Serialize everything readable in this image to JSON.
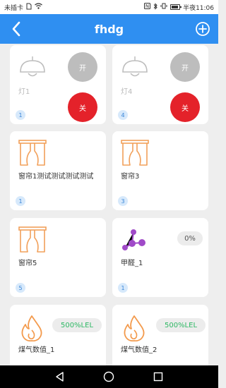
{
  "status": {
    "carrier": "未插卡",
    "time_label": "半夜11:06"
  },
  "header": {
    "title": "fhdg"
  },
  "cards": {
    "light1": {
      "name": "灯1",
      "on_label": "开",
      "off_label": "关",
      "badge": "1"
    },
    "light4": {
      "name": "灯4",
      "on_label": "开",
      "off_label": "关",
      "badge": "4"
    },
    "curtain1": {
      "name": "窗帘1测试测试测试测试",
      "badge": "1"
    },
    "curtain3": {
      "name": "窗帘3",
      "badge": "3"
    },
    "curtain5": {
      "name": "窗帘5",
      "badge": "5"
    },
    "formaldehyde": {
      "name": "甲醛_1",
      "value": "0%",
      "badge": "1"
    },
    "gas1": {
      "name": "煤气数值_1",
      "value": "500%LEL"
    },
    "gas2": {
      "name": "煤气数值_2",
      "value": "500%LEL"
    }
  },
  "colors": {
    "header": "#2f8ff1",
    "off_button": "#e4222a",
    "on_button": "#bdbdbd",
    "curtain_icon": "#f2a05a",
    "flame_icon": "#f39a4c",
    "molecule_icon": "#a04ac8",
    "gas_value": "#2eb864"
  }
}
